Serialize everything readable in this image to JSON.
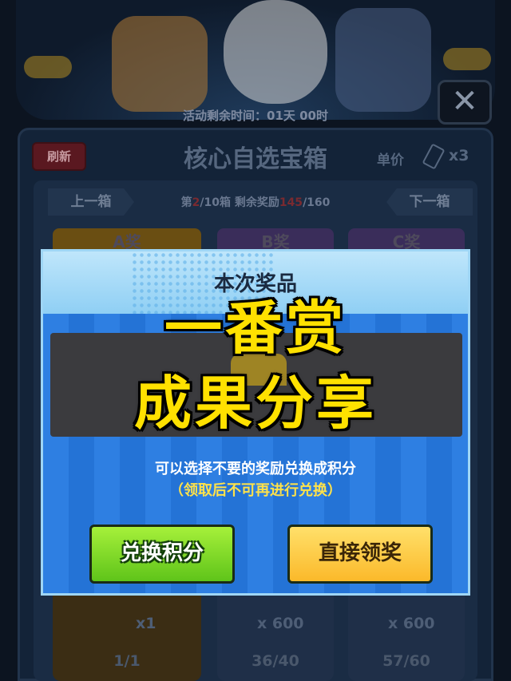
{
  "event": {
    "time_left": "活动剩余时间：01天 00时"
  },
  "header": {
    "close_glyph": "✕"
  },
  "panel": {
    "refresh_label": "刷新",
    "title": "核心自选宝箱",
    "price_label": "单价",
    "price_qty": "x3",
    "prev_label": "上一箱",
    "next_label": "下一箱",
    "progress": {
      "box_prefix": "第",
      "box_current": "2",
      "box_rest": "/10箱  剩余奖励",
      "remaining": "145",
      "remaining_total": "/160"
    },
    "tiers": [
      "A奖",
      "B奖",
      "C奖"
    ],
    "cards": [
      {
        "reward_count": "x1",
        "stock": "1/1"
      },
      {
        "reward_count": "x 600",
        "stock": "36/40"
      },
      {
        "reward_count": "x 600",
        "stock": "57/60"
      }
    ]
  },
  "modal": {
    "title": "本次奖品",
    "info_line1": "可以选择不要的奖励兑换成积分",
    "info_line2": "（领取后不可再进行兑换）",
    "exchange_label": "兑换积分",
    "claim_label": "直接领奖"
  },
  "overlay": {
    "line1": "一番赏",
    "line2": "成果分享"
  },
  "colors": {
    "headline": "#ffe100",
    "exchange_button": "#7fd62a",
    "claim_button": "#fdc83a",
    "modal_blue": "#2a7ade"
  },
  "icons": [
    "close-icon",
    "ticket-icon",
    "coin-icon"
  ]
}
